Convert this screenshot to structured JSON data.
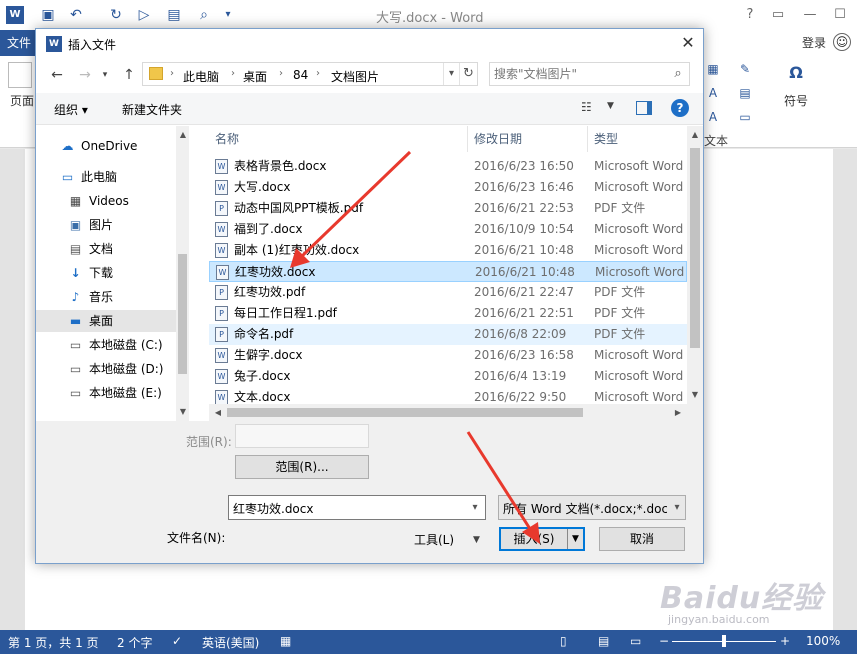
{
  "word": {
    "logo": "W",
    "title": "大写.docx - Word",
    "help": "?",
    "file_tab": "文件",
    "login": "登录",
    "ribbon": {
      "left_label": "页面",
      "text_label": "文本",
      "symbol_glyph": "Ω",
      "symbol_label": "符号"
    },
    "status": {
      "page": "第 1 页，共 1 页",
      "words": "2 个字",
      "language": "英语(美国)",
      "zoom": "100%",
      "zoom_level": 0.5
    }
  },
  "dialog": {
    "logo": "W",
    "title": "插入文件",
    "breadcrumbs": [
      "此电脑",
      "桌面",
      "84",
      "文档图片"
    ],
    "search_placeholder": "搜索\"文档图片\"",
    "toolbar": {
      "organize": "组织 ▾",
      "new_folder": "新建文件夹"
    },
    "nav": [
      {
        "label": "OneDrive",
        "icon": "cloud-icon"
      },
      {
        "label": "此电脑",
        "icon": "computer-icon"
      },
      {
        "label": "Videos",
        "icon": "video-icon"
      },
      {
        "label": "图片",
        "icon": "pictures-icon"
      },
      {
        "label": "文档",
        "icon": "documents-icon"
      },
      {
        "label": "下载",
        "icon": "download-icon"
      },
      {
        "label": "音乐",
        "icon": "music-icon"
      },
      {
        "label": "桌面",
        "icon": "desktop-icon"
      },
      {
        "label": "本地磁盘 (C:)",
        "icon": "drive-icon"
      },
      {
        "label": "本地磁盘 (D:)",
        "icon": "drive-icon"
      },
      {
        "label": "本地磁盘 (E:)",
        "icon": "drive-icon"
      }
    ],
    "columns": {
      "name": "名称",
      "date": "修改日期",
      "type": "类型"
    },
    "files": [
      {
        "name": "表格背景色.docx",
        "date": "2016/6/23 16:50",
        "type": "Microsoft Word"
      },
      {
        "name": "大写.docx",
        "date": "2016/6/23 16:46",
        "type": "Microsoft Word"
      },
      {
        "name": "动态中国风PPT模板.pdf",
        "date": "2016/6/21 22:53",
        "type": "PDF 文件"
      },
      {
        "name": "福到了.docx",
        "date": "2016/10/9 10:54",
        "type": "Microsoft Word"
      },
      {
        "name": "副本 (1)红枣功效.docx",
        "date": "2016/6/21 10:48",
        "type": "Microsoft Word"
      },
      {
        "name": "红枣功效.docx",
        "date": "2016/6/21 10:48",
        "type": "Microsoft Word"
      },
      {
        "name": "红枣功效.pdf",
        "date": "2016/6/21 22:47",
        "type": "PDF 文件"
      },
      {
        "name": "每日工作日程1.pdf",
        "date": "2016/6/21 22:51",
        "type": "PDF 文件"
      },
      {
        "name": "命令名.pdf",
        "date": "2016/6/8 22:09",
        "type": "PDF 文件"
      },
      {
        "name": "生僻字.docx",
        "date": "2016/6/23 16:58",
        "type": "Microsoft Word"
      },
      {
        "name": "兔子.docx",
        "date": "2016/6/4 13:19",
        "type": "Microsoft Word"
      },
      {
        "name": "文本.docx",
        "date": "2016/6/22 9:50",
        "type": "Microsoft Word"
      }
    ],
    "range_label": "范围(R):",
    "range_button": "范围(R)...",
    "filename_label": "文件名(N):",
    "filename_value": "红枣功效.docx",
    "filetype_value": "所有 Word 文档(*.docx;*.docm",
    "tools": "工具(L)",
    "insert": "插入(S)",
    "cancel": "取消"
  },
  "watermark": {
    "brand": "Baidu经验",
    "sub": "jingyan.baidu.com"
  },
  "colors": {
    "word_blue": "#2b579a",
    "selection": "#cce8ff",
    "arrow_red": "#e8392d"
  }
}
